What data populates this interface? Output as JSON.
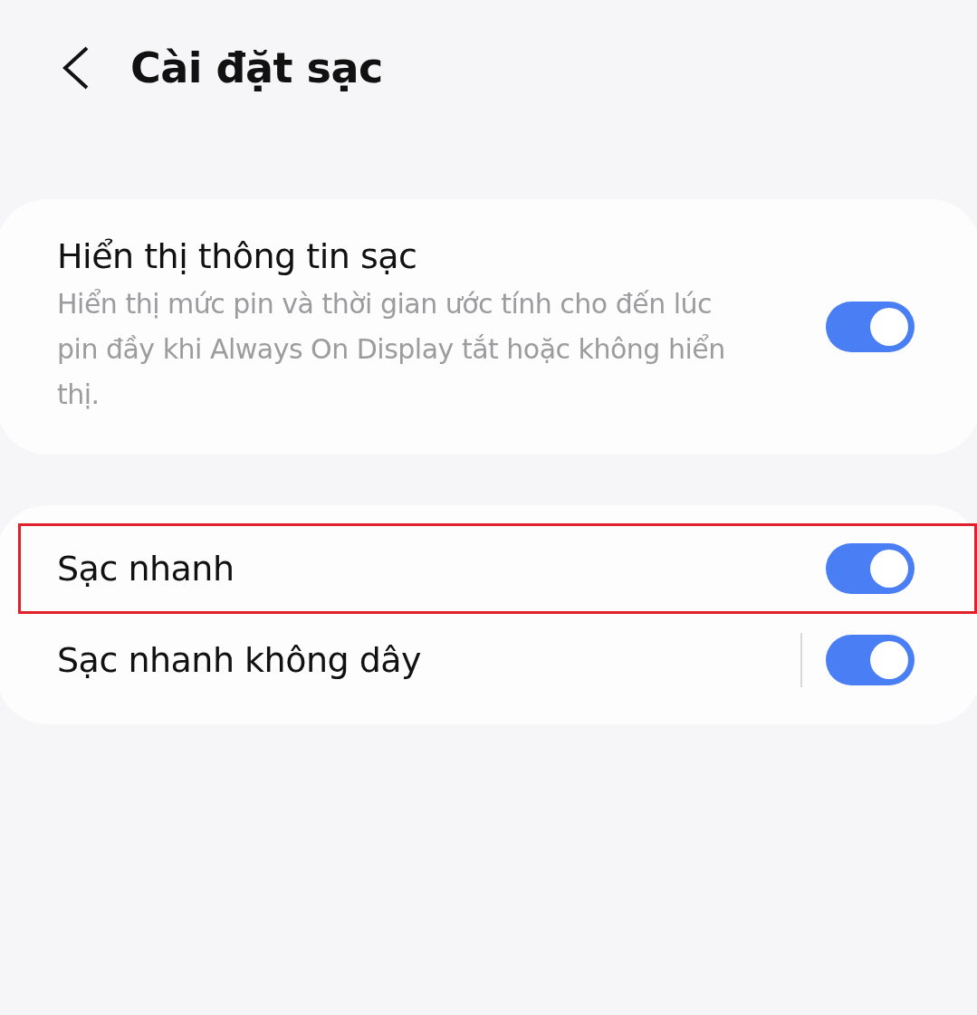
{
  "header": {
    "title": "Cài đặt sạc"
  },
  "groups": [
    {
      "items": [
        {
          "title": "Hiển thị thông tin sạc",
          "subtitle": "Hiển thị mức pin và thời gian ước tính cho đến lúc pin đầy khi Always On Display tắt hoặc không hiển thị.",
          "on": true,
          "divider": false,
          "highlighted": false
        }
      ]
    },
    {
      "items": [
        {
          "title": "Sạc nhanh",
          "on": true,
          "divider": false,
          "highlighted": true
        },
        {
          "title": "Sạc nhanh không dây",
          "on": true,
          "divider": true,
          "highlighted": false
        }
      ]
    }
  ]
}
